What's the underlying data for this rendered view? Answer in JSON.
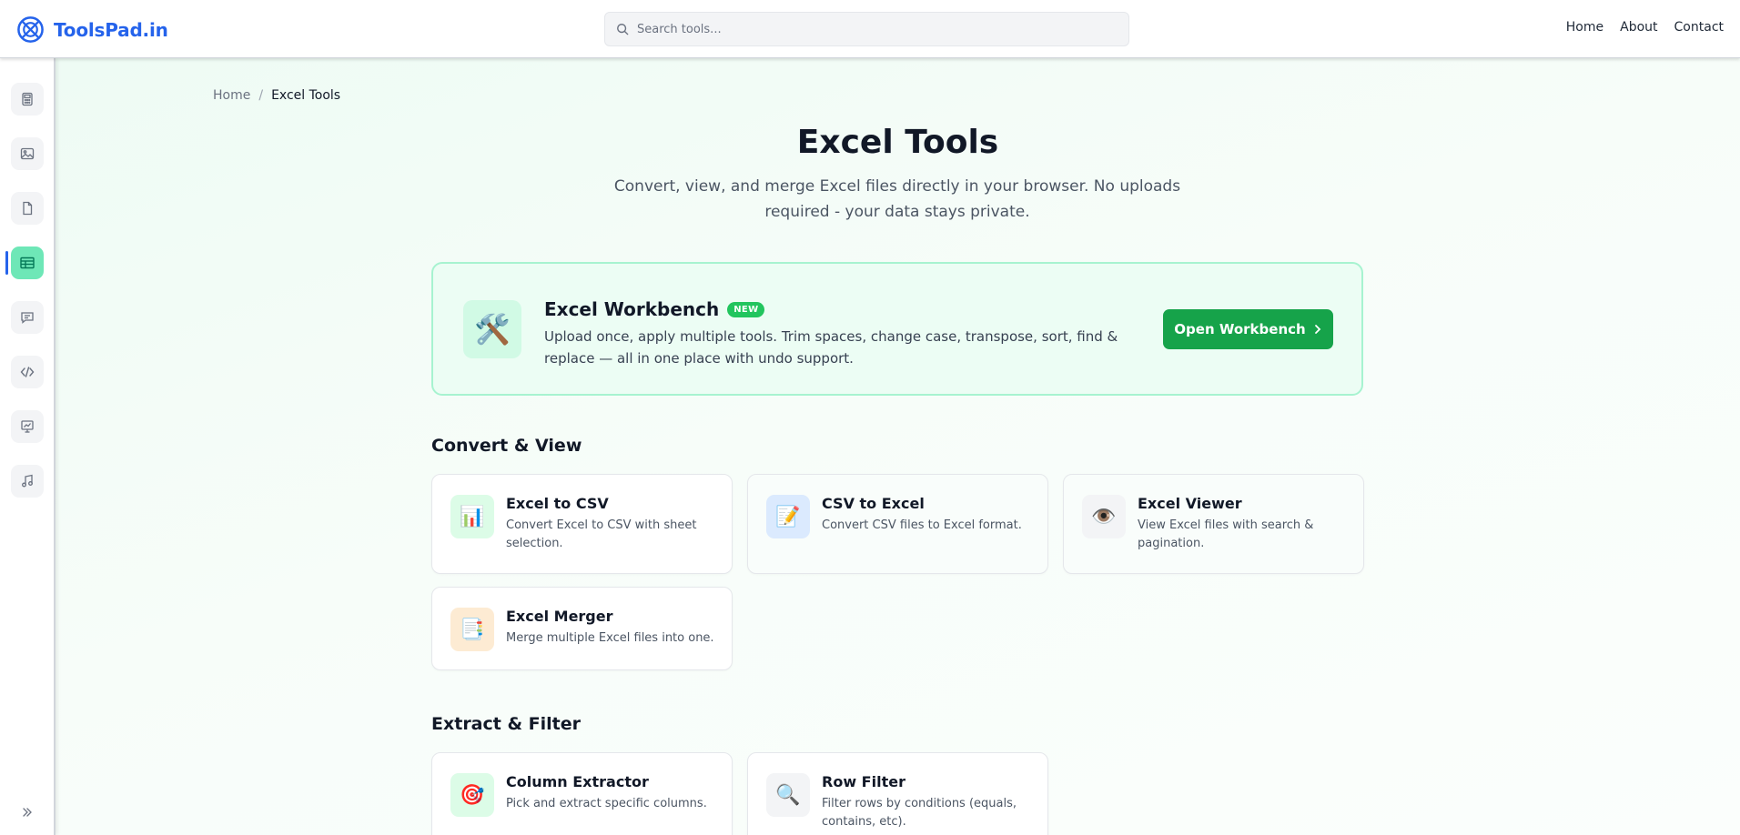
{
  "header": {
    "brand_name": "ToolsPad.in",
    "search_placeholder": "Search tools...",
    "nav": [
      "Home",
      "About",
      "Contact"
    ]
  },
  "sidebar": {
    "items": [
      {
        "icon": "calculator-icon",
        "active": false
      },
      {
        "icon": "image-icon",
        "active": false
      },
      {
        "icon": "file-icon",
        "active": false
      },
      {
        "icon": "spreadsheet-icon",
        "active": true
      },
      {
        "icon": "chat-icon",
        "active": false
      },
      {
        "icon": "code-icon",
        "active": false
      },
      {
        "icon": "presentation-icon",
        "active": false
      },
      {
        "icon": "music-icon",
        "active": false
      }
    ],
    "expand_icon": "chevrons-right-icon"
  },
  "breadcrumb": {
    "home": "Home",
    "separator": "/",
    "current": "Excel Tools"
  },
  "page": {
    "title": "Excel Tools",
    "subtitle": "Convert, view, and merge Excel files directly in your browser. No uploads required - your data stays private."
  },
  "workbench": {
    "icon": "🛠️",
    "title": "Excel Workbench",
    "badge": "NEW",
    "description": "Upload once, apply multiple tools. Trim spaces, change case, transpose, sort, find & replace — all in one place with undo support.",
    "button_label": "Open Workbench"
  },
  "sections": [
    {
      "title": "Convert & View",
      "tools": [
        {
          "icon": "📊",
          "icon_bg": "#dcfce7",
          "title": "Excel to CSV",
          "description": "Convert Excel to CSV with sheet selection."
        },
        {
          "icon": "📝",
          "icon_bg": "#dbeafe",
          "title": "CSV to Excel",
          "description": "Convert CSV files to Excel format."
        },
        {
          "icon": "👁️",
          "icon_bg": "#f3f4f6",
          "title": "Excel Viewer",
          "description": "View Excel files with search & pagination."
        },
        {
          "icon": "📑",
          "icon_bg": "#fdebd3",
          "title": "Excel Merger",
          "description": "Merge multiple Excel files into one."
        }
      ]
    },
    {
      "title": "Extract & Filter",
      "tools": [
        {
          "icon": "🎯",
          "icon_bg": "#dcfce7",
          "title": "Column Extractor",
          "description": "Pick and extract specific columns."
        },
        {
          "icon": "🔍",
          "icon_bg": "#f3f4f6",
          "title": "Row Filter",
          "description": "Filter rows by conditions (equals, contains, etc)."
        }
      ]
    }
  ],
  "colors": {
    "brand": "#2563eb",
    "accent_green": "#16a34a",
    "badge_green": "#22c55e",
    "active_sidebar": "#6ee7b7"
  }
}
